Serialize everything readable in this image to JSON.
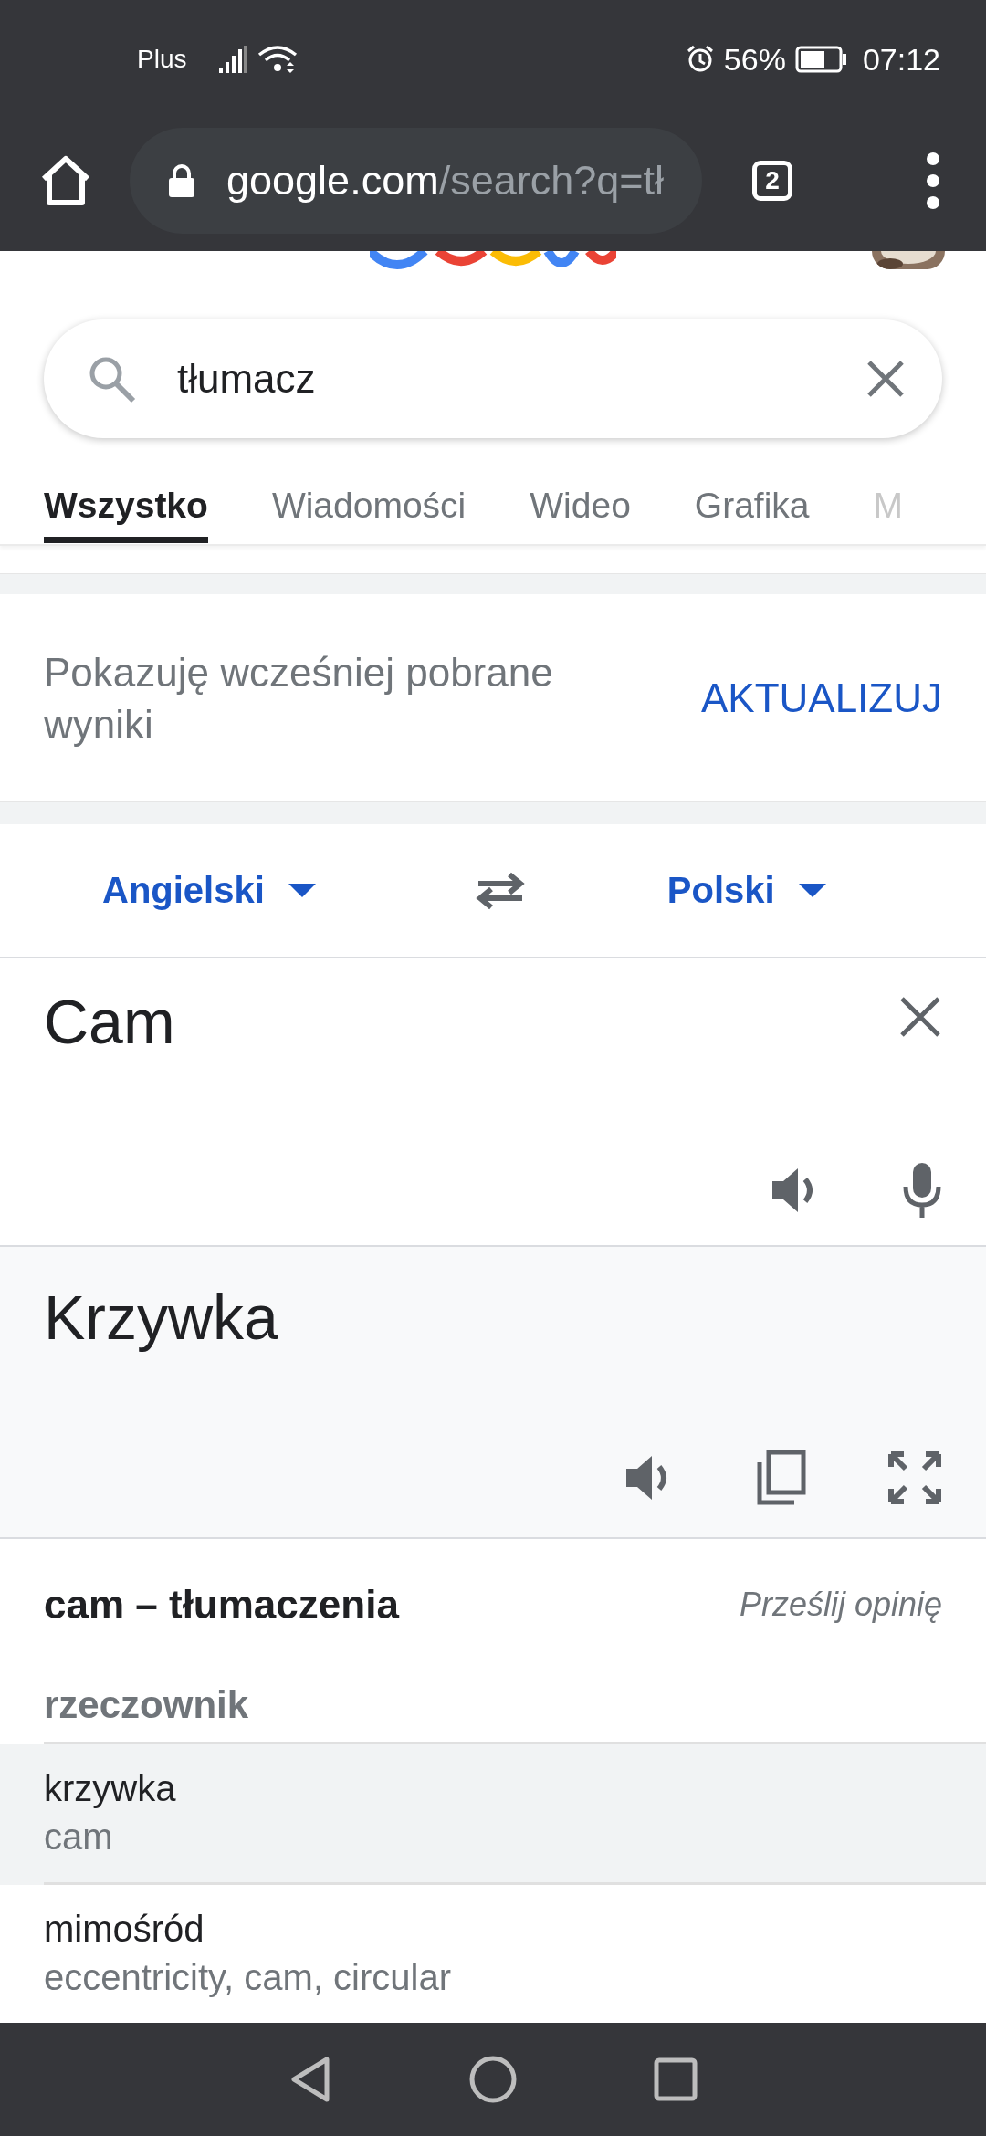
{
  "status_bar": {
    "carrier": "Plus",
    "battery": "56%",
    "time": "07:12"
  },
  "browser": {
    "url_domain": "google.com",
    "url_path": "/search?q=tł",
    "tab_count": "2"
  },
  "search": {
    "value": "tłumacz"
  },
  "tabs": [
    {
      "label": "Wszystko",
      "selected": true
    },
    {
      "label": "Wiadomości",
      "selected": false
    },
    {
      "label": "Wideo",
      "selected": false
    },
    {
      "label": "Grafika",
      "selected": false
    },
    {
      "label": "M",
      "selected": false
    }
  ],
  "notice": {
    "text": "Pokazuję wcześniej pobrane wyniki",
    "action": "AKTUALIZUJ"
  },
  "translator": {
    "source_language": "Angielski",
    "target_language": "Polski",
    "input": "Cam",
    "output": "Krzywka"
  },
  "dictionary": {
    "title": "cam – tłumaczenia",
    "feedback": "Prześlij opinię",
    "part_of_speech": "rzeczownik",
    "entries": [
      {
        "word": "krzywka",
        "synonyms": "cam",
        "highlighted": true
      },
      {
        "word": "mimośród",
        "synonyms": "eccentricity, cam, circular",
        "highlighted": false
      }
    ]
  }
}
